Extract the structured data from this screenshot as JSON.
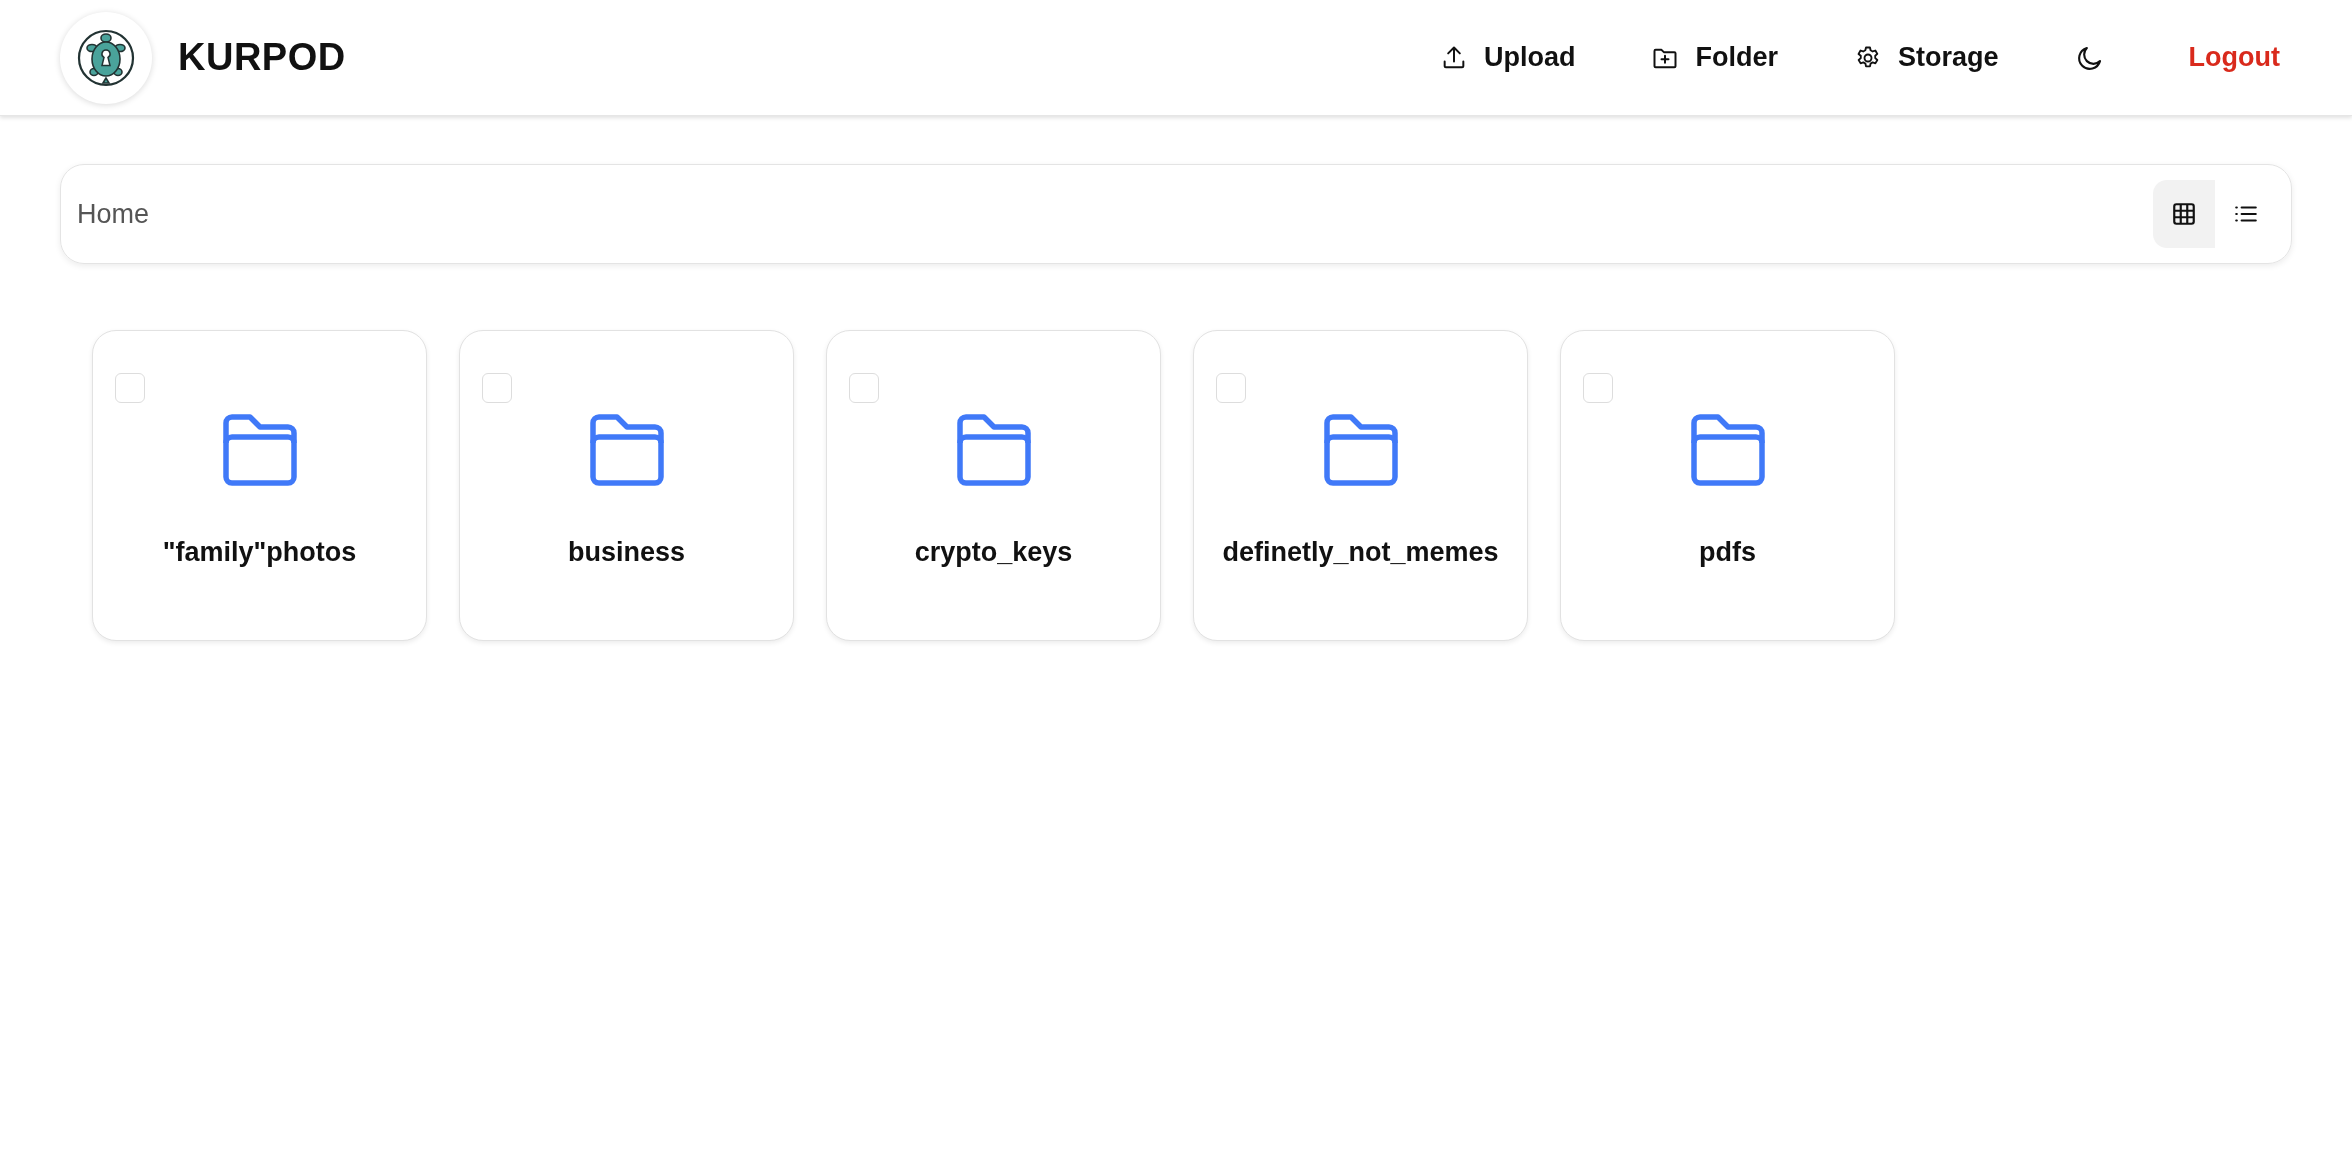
{
  "header": {
    "brand": "KURPOD",
    "actions": [
      {
        "kind": "upload",
        "label": "Upload"
      },
      {
        "kind": "folder",
        "label": "Folder"
      },
      {
        "kind": "storage",
        "label": "Storage"
      },
      {
        "kind": "theme"
      },
      {
        "kind": "logout",
        "label": "Logout"
      }
    ]
  },
  "breadcrumb": {
    "path": "Home"
  },
  "view_modes": [
    {
      "kind": "grid",
      "selected": true
    },
    {
      "kind": "list",
      "selected": false
    }
  ],
  "folders": [
    {
      "name": "\"family\"photos",
      "checked": false
    },
    {
      "name": "business",
      "checked": false
    },
    {
      "name": "crypto_keys",
      "checked": false
    },
    {
      "name": "definetly_not_memes",
      "checked": false
    },
    {
      "name": "pdfs",
      "checked": false
    }
  ]
}
